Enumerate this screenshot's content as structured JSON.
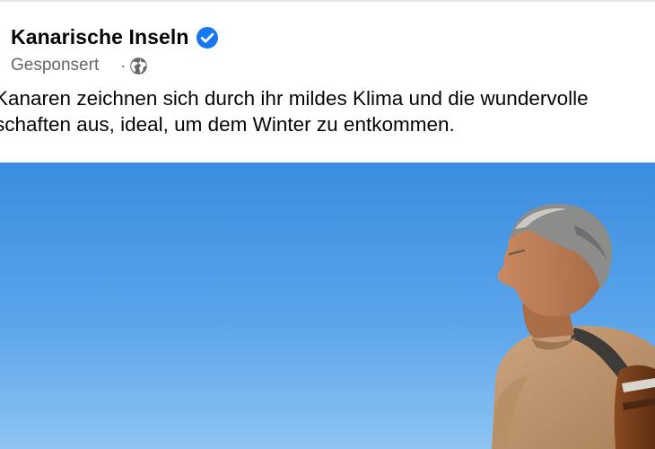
{
  "post": {
    "page_name": "Kanarische Inseln",
    "verified_icon": "verified-badge-icon",
    "sponsored_label": "Gesponsert",
    "separator": "·",
    "audience_icon": "globe-icon",
    "caption_line_1": "Kanaren zeichnen sich durch ihr mildes Klima und die wundervolle",
    "caption_line_2": "schaften aus, ideal, um dem Winter zu entkommen.",
    "colors": {
      "verified_blue": "#1877f2",
      "meta_gray": "#65676b",
      "sky_top": "#3d8fe0",
      "sky_bottom": "#8dc3f3"
    }
  }
}
